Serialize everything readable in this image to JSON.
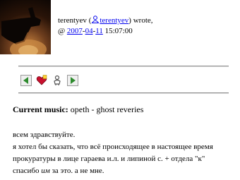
{
  "post": {
    "author": "terentyev",
    "author_link": "terentyev",
    "wrote": "wrote,",
    "at": "@",
    "date_year": "2007",
    "date_month": "04",
    "date_day": "11",
    "time": "15:07:00"
  },
  "icons": {
    "userpic": "userpic-hand-fire",
    "user_icon": "livejournal-user-icon",
    "toolbar": [
      "prev-entry-icon",
      "add-to-memories-icon",
      "tell-a-friend-icon",
      "next-entry-icon"
    ]
  },
  "current_music": {
    "label": "Current music:",
    "value": "opeth - ghost reveries"
  },
  "body": {
    "line1": "всем здравствуйте.",
    "line2": "я хотел бы сказать, что всё происходящее в настоящее время",
    "line3": "прокуратуры в лице гараева и.л. и липиной с. + отдела \"к\"",
    "line4_a": "спасибо ",
    "line4_em": "им",
    "line4_b": " за это. а не мне."
  },
  "colors": {
    "link": "#0000ee",
    "toolbar_arrow": "#2e8b2e"
  }
}
